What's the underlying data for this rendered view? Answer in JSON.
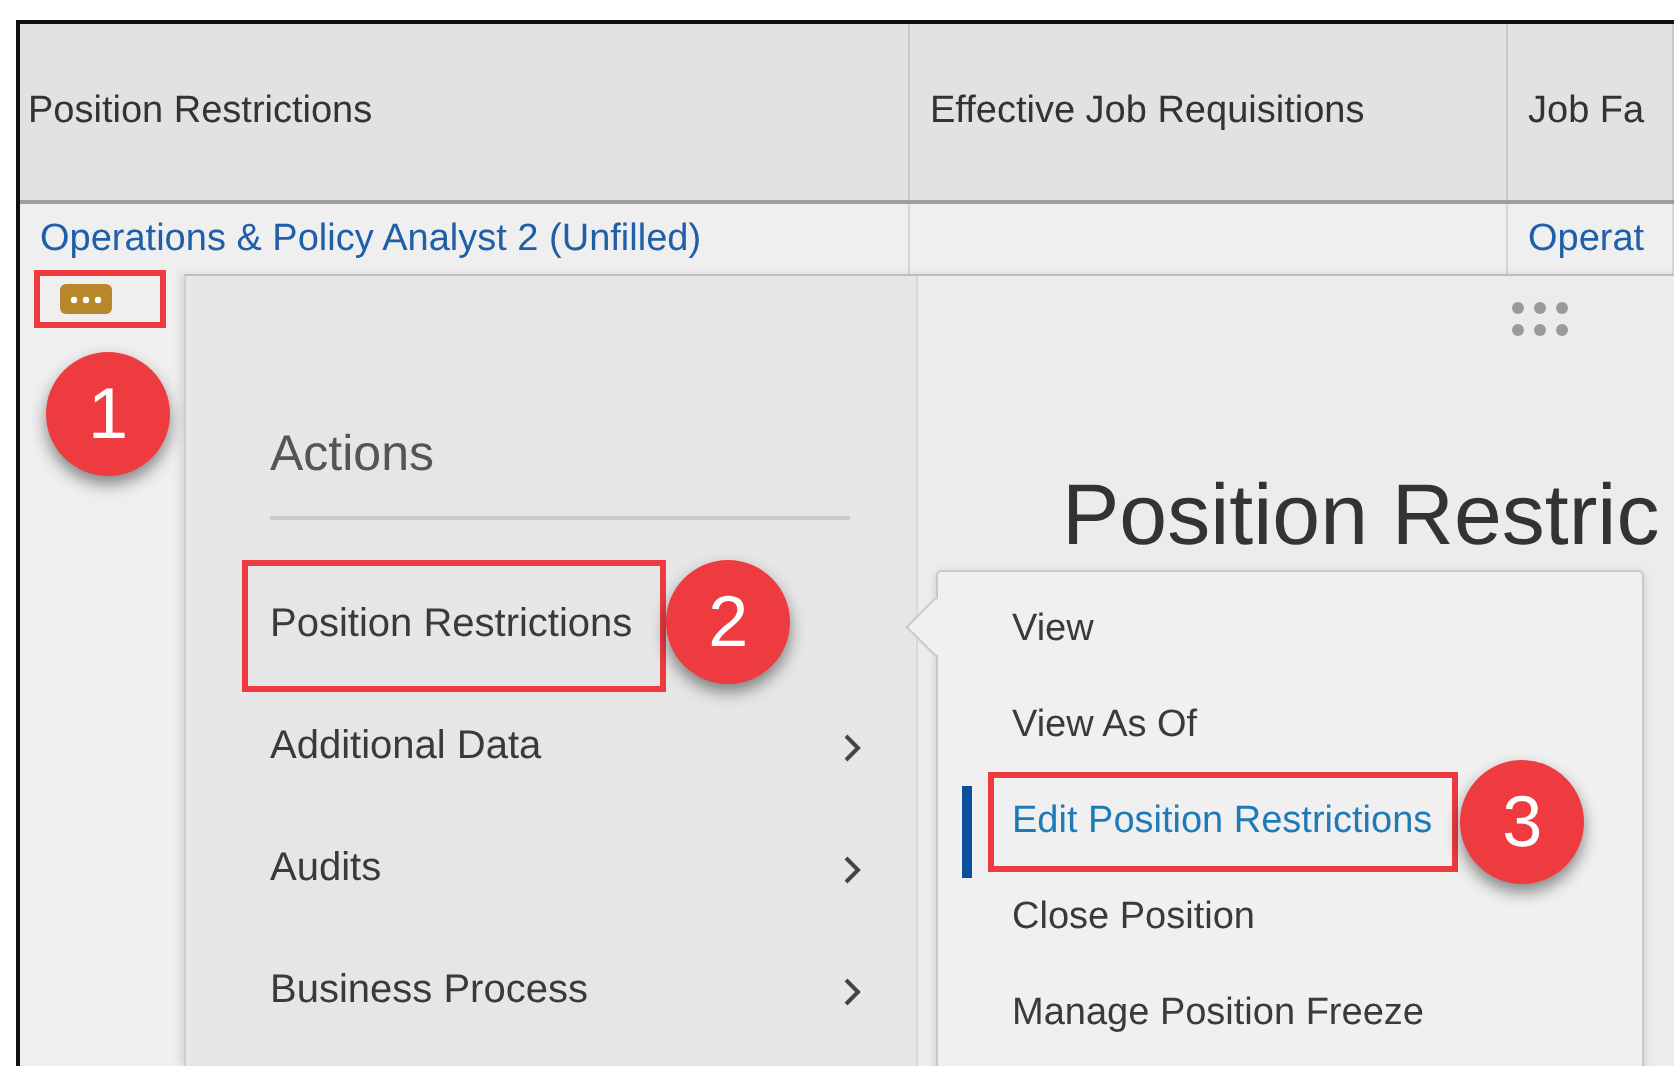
{
  "table": {
    "columns": [
      "Position Restrictions",
      "Effective Job Requisitions",
      "Job Fa"
    ],
    "rows": [
      {
        "column_1": "Operations & Policy Analyst 2 (Unfilled)",
        "column_3": "Operat",
        "actions_button": {
          "callout": "1"
        }
      }
    ]
  },
  "preview": {
    "title": "Position Restric"
  },
  "actions_menu": {
    "title": "Actions",
    "items": [
      {
        "label": "Position Restrictions",
        "has_submenu": false,
        "callout": "2"
      },
      {
        "label": "Additional Data",
        "has_submenu": true
      },
      {
        "label": "Audits",
        "has_submenu": true
      },
      {
        "label": "Business Process",
        "has_submenu": true
      }
    ]
  },
  "submenu": {
    "items": [
      {
        "label": "View",
        "selected": false
      },
      {
        "label": "View As Of",
        "selected": false
      },
      {
        "label": "Edit Position Restrictions",
        "selected": true,
        "callout": "3"
      },
      {
        "label": "Close Position",
        "selected": false
      },
      {
        "label": "Manage Position Freeze",
        "selected": false
      }
    ]
  }
}
